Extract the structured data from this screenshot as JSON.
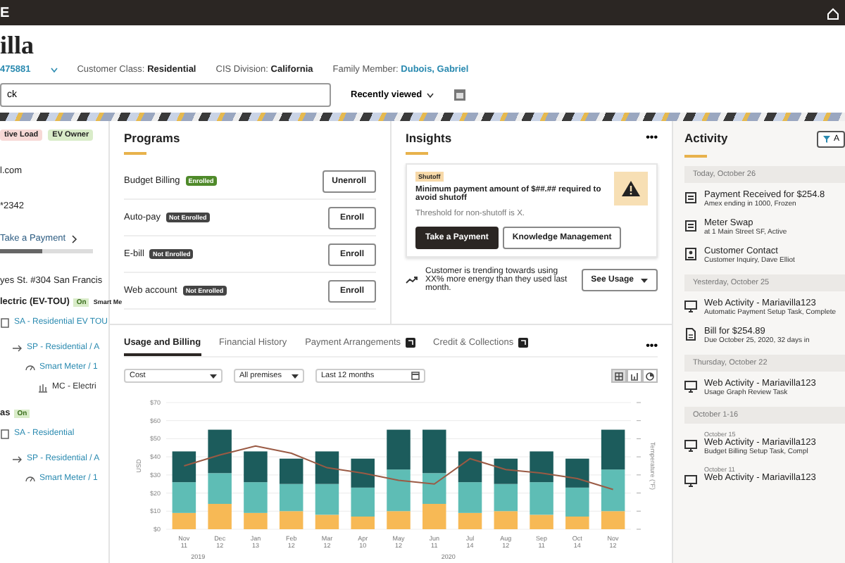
{
  "top_bar": {
    "text": "E"
  },
  "header": {
    "title": "illa",
    "account": "475881",
    "fields": [
      {
        "label": "Customer Class:",
        "value": "Residential",
        "link": false
      },
      {
        "label": "CIS Division:",
        "value": "California",
        "link": false
      },
      {
        "label": "Family Member:",
        "value": "Dubois, Gabriel",
        "link": true
      }
    ],
    "search": {
      "value": "ck"
    },
    "recent": "Recently viewed"
  },
  "left": {
    "badges": [
      {
        "label": "tive Load",
        "color": "#f7d9d6"
      },
      {
        "label": "EV Owner",
        "color": "#d9ecc9"
      }
    ],
    "email": "l.com",
    "phone": "*2342",
    "payment_link": "Take a Payment",
    "progress": {
      "level": 0.45
    },
    "address": "yes St. #304 San Francis",
    "services": [
      {
        "name": "lectric (EV-TOU)",
        "status": "On",
        "extra": "Smart Me",
        "tree": [
          {
            "label": "SA - Residential EV TOU",
            "kind": "sa",
            "children": [
              {
                "label": "SP - Residential / A",
                "kind": "sp",
                "children": [
                  {
                    "label": "Smart Meter / 1",
                    "kind": "meter",
                    "children": [
                      {
                        "label": "MC - Electri",
                        "kind": "mc"
                      }
                    ]
                  }
                ]
              }
            ]
          }
        ]
      },
      {
        "name": "as",
        "status": "On",
        "tree": [
          {
            "label": "SA - Residential",
            "kind": "sa",
            "children": [
              {
                "label": "SP - Residential / A",
                "kind": "sp",
                "children": [
                  {
                    "label": "Smart Meter / 1",
                    "kind": "meter"
                  }
                ]
              }
            ]
          }
        ]
      }
    ]
  },
  "programs": {
    "title": "Programs",
    "items": [
      {
        "name": "Budget Billing",
        "enrolled": true,
        "badge": "Enrolled",
        "action": "Unenroll"
      },
      {
        "name": "Auto-pay",
        "enrolled": false,
        "badge": "Not Enrolled",
        "action": "Enroll"
      },
      {
        "name": "E-bill",
        "enrolled": false,
        "badge": "Not Enrolled",
        "action": "Enroll"
      },
      {
        "name": "Web account",
        "enrolled": false,
        "badge": "Not Enrolled",
        "action": "Enroll"
      }
    ]
  },
  "insights": {
    "title": "Insights",
    "menu": "•••",
    "alert": {
      "tag": "Shutoff",
      "message": "Minimum payment amount of $##.## required to avoid shutoff",
      "detail": "Threshold for non-shutoff is X.",
      "buttons": [
        {
          "label": "Take a Payment",
          "primary": true
        },
        {
          "label": "Knowledge Management",
          "primary": false
        }
      ]
    },
    "trend": {
      "text": "Customer is trending towards using XX% more energy than they used last month.",
      "button": "See Usage"
    }
  },
  "usage": {
    "tabs": [
      {
        "label": "Usage and Billing",
        "selected": true,
        "icon": false
      },
      {
        "label": "Financial History",
        "selected": false,
        "icon": false
      },
      {
        "label": "Payment Arrangements",
        "selected": false,
        "icon": true
      },
      {
        "label": "Credit & Collections",
        "selected": false,
        "icon": true
      }
    ],
    "menu": "•••",
    "filters": [
      {
        "value": "Cost",
        "kind": "select"
      },
      {
        "value": "All premises",
        "kind": "select"
      },
      {
        "value": "Last 12 months",
        "kind": "date"
      }
    ],
    "views": [
      {
        "selected": true
      },
      {
        "selected": false
      },
      {
        "selected": false
      }
    ],
    "right_axis_label": "Temperature (°F)",
    "chart_data": {
      "type": "bar",
      "stacked": true,
      "grid": true,
      "ylabel": "USD",
      "categories": [
        "Nov 11",
        "Dec 12",
        "Jan 13",
        "Feb 12",
        "Mar 12",
        "Apr 10",
        "May 12",
        "Jun 11",
        "Jul 14",
        "Aug 12",
        "Sep 11",
        "Oct 14",
        "Nov 12"
      ],
      "ylim": [
        0,
        70
      ],
      "yticks": [
        {
          "value": 0,
          "label": "$0"
        },
        {
          "value": 10,
          "label": "$10"
        },
        {
          "value": 20,
          "label": "$20"
        },
        {
          "value": 30,
          "label": "$30"
        },
        {
          "value": 40,
          "label": "$40"
        },
        {
          "value": 50,
          "label": "$50"
        },
        {
          "value": 60,
          "label": "$60"
        },
        {
          "value": 70,
          "label": "$70"
        }
      ],
      "series": [
        {
          "color": "#f7b955",
          "values": [
            9,
            14,
            9,
            10,
            8,
            7,
            10,
            14,
            9,
            10,
            8,
            7,
            10
          ]
        },
        {
          "color": "#5ebdb5",
          "values": [
            17,
            17,
            17,
            15,
            17,
            16,
            23,
            17,
            17,
            15,
            18,
            16,
            23
          ]
        },
        {
          "color": "#1c5c5c",
          "values": [
            17,
            24,
            17,
            14,
            18,
            16,
            22,
            24,
            17,
            14,
            17,
            16,
            22
          ]
        },
        {
          "type": "line",
          "color": "#9a5a44",
          "values": [
            35,
            41,
            46,
            42,
            34,
            31,
            27,
            25,
            39,
            33,
            31,
            28,
            22
          ]
        }
      ],
      "annotations": [
        "2019",
        "2020"
      ]
    }
  },
  "activity": {
    "title": "Activity",
    "filter": "A",
    "groups": [
      {
        "date": "Today, October 26",
        "items": [
          {
            "kind": "receipt",
            "title": "Payment Received for $254.8",
            "detail": "Amex ending in 1000, Frozen"
          },
          {
            "kind": "receipt",
            "title": "Meter Swap",
            "detail": "at 1 Main Street SF, Active"
          },
          {
            "kind": "contact",
            "title": "Customer Contact",
            "detail": "Customer Inquiry, Dave Elliot"
          }
        ]
      },
      {
        "date": "Yesterday, October 25",
        "items": [
          {
            "kind": "web",
            "title": "Web Activity - Mariavilla123",
            "detail": "Automatic Payment Setup Task, Complete"
          },
          {
            "kind": "bill",
            "title": "Bill for $254.89",
            "detail": "Due October 25, 2020, 32 days in"
          }
        ]
      },
      {
        "date": "Thursday, October 22",
        "items": [
          {
            "kind": "web",
            "title": "Web Activity - Mariavilla123",
            "detail": "Usage Graph Review Task"
          }
        ]
      },
      {
        "date": "October 1-16",
        "items": [
          {
            "kind": "web",
            "date": "October 15",
            "title": "Web Activity - Mariavilla123",
            "detail": "Budget Billing Setup Task, Compl"
          },
          {
            "kind": "web",
            "date": "October 11",
            "title": "Web Activity - Mariavilla123"
          }
        ]
      }
    ]
  }
}
